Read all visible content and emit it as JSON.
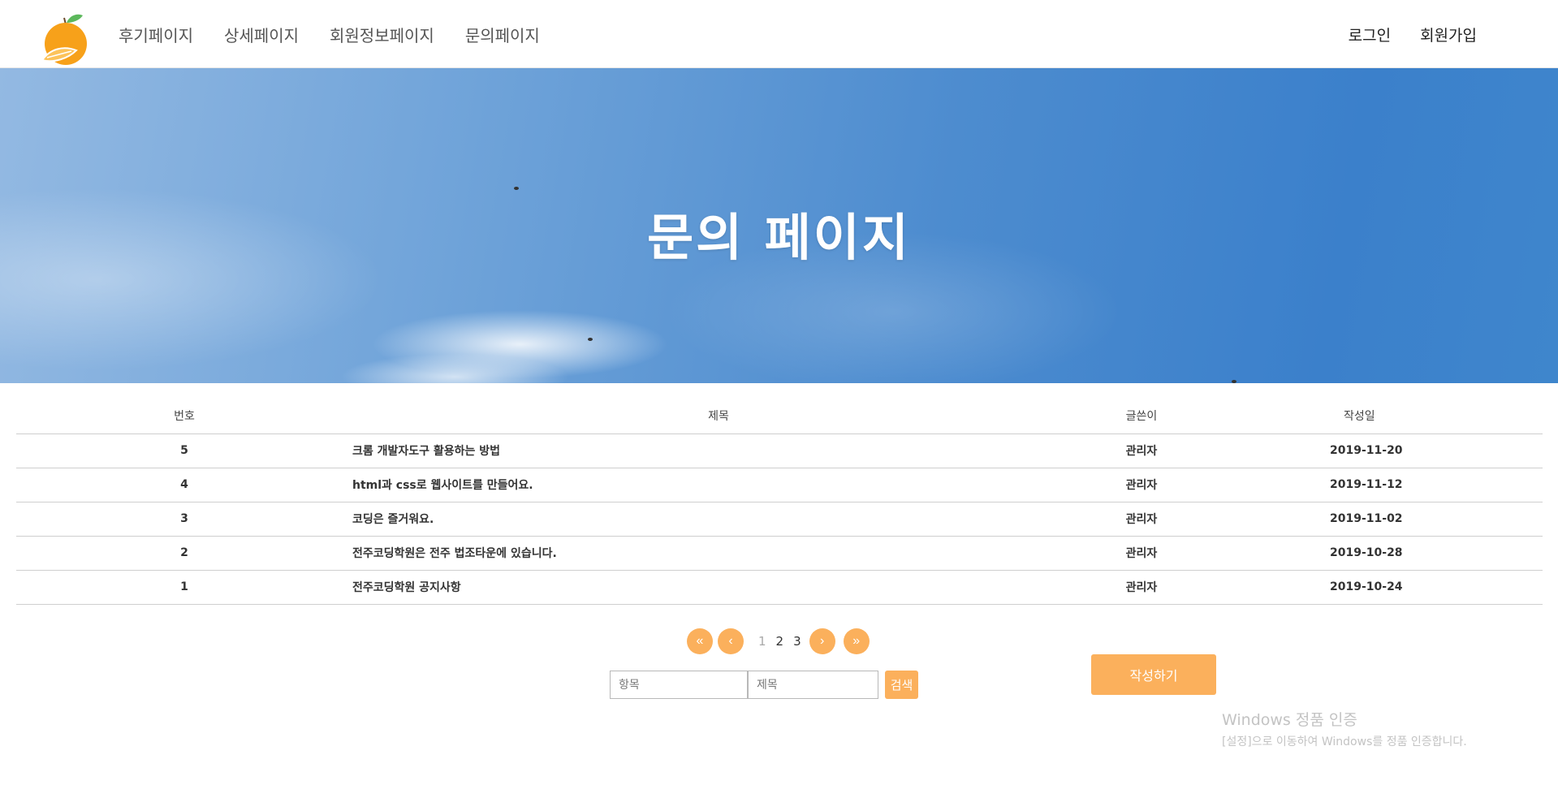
{
  "header": {
    "nav": [
      "후기페이지",
      "상세페이지",
      "회원정보페이지",
      "문의페이지"
    ],
    "login": "로그인",
    "signup": "회원가입"
  },
  "hero": {
    "title": "문의 페이지"
  },
  "board": {
    "columns": {
      "num": "번호",
      "title": "제목",
      "writer": "글쓴이",
      "date": "작성일"
    },
    "rows": [
      {
        "num": "5",
        "title": "크롬 개발자도구 활용하는 방법",
        "writer": "관리자",
        "date": "2019-11-20"
      },
      {
        "num": "4",
        "title": "html과 css로 웹사이트를 만들어요.",
        "writer": "관리자",
        "date": "2019-11-12"
      },
      {
        "num": "3",
        "title": "코딩은 즐거워요.",
        "writer": "관리자",
        "date": "2019-11-02"
      },
      {
        "num": "2",
        "title": "전주코딩학원은 전주 법조타운에 있습니다.",
        "writer": "관리자",
        "date": "2019-10-28"
      },
      {
        "num": "1",
        "title": "전주코딩학원 공지사항",
        "writer": "관리자",
        "date": "2019-10-24"
      }
    ]
  },
  "pager": {
    "first": "«",
    "prev": "‹",
    "next": "›",
    "last": "»",
    "pages": [
      "1",
      "2",
      "3"
    ]
  },
  "search": {
    "category_placeholder": "항목",
    "title_placeholder": "제목",
    "button": "검색"
  },
  "write_button": "작성하기",
  "watermark": {
    "line1": "Windows 정품 인증",
    "line2": "[설정]으로 이동하여 Windows를 정품 인증합니다."
  },
  "colors": {
    "accent": "#fbb05c",
    "logo_orange": "#f7a11a",
    "logo_leaf": "#5cb85c"
  }
}
